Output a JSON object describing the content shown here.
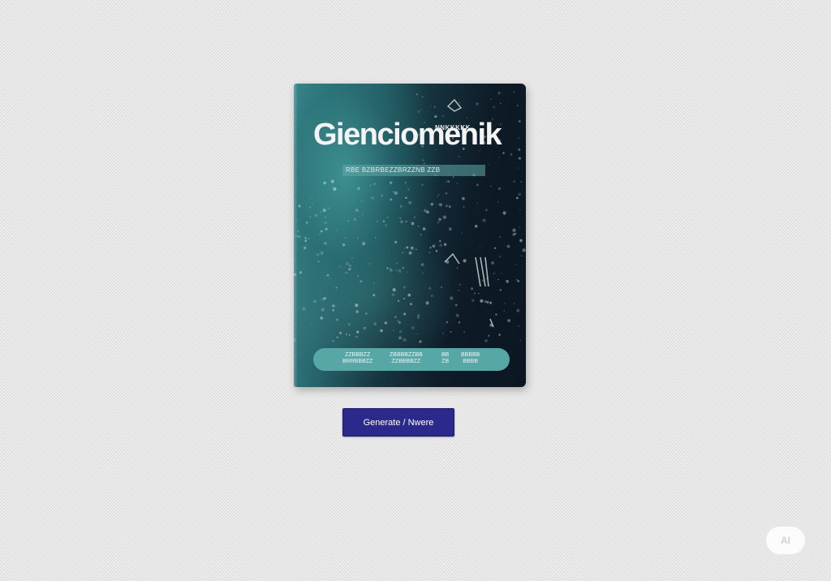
{
  "book": {
    "title": "Gienciomenik",
    "kicker": "NNKKKKK",
    "subtitle": "RBE BZBRBEZZBRZZNB ZZB",
    "footer": {
      "col1": "ZZBBBZZ\nBRRBBBZZ",
      "col2": "ZBBBBZZBB\nZZBBBBZZ",
      "col3": "BB\nZB",
      "col4": "BBBBB\nBBBB"
    }
  },
  "action_button": {
    "label": "Generate / Nwere"
  },
  "corner_badge": {
    "label": "AI"
  },
  "colors": {
    "button_bg": "#2b2a8c",
    "cover_teal": "#3d8f93",
    "cover_dark": "#0e1c28",
    "footer_pill": "#58a7a7",
    "background": "#ececec"
  }
}
